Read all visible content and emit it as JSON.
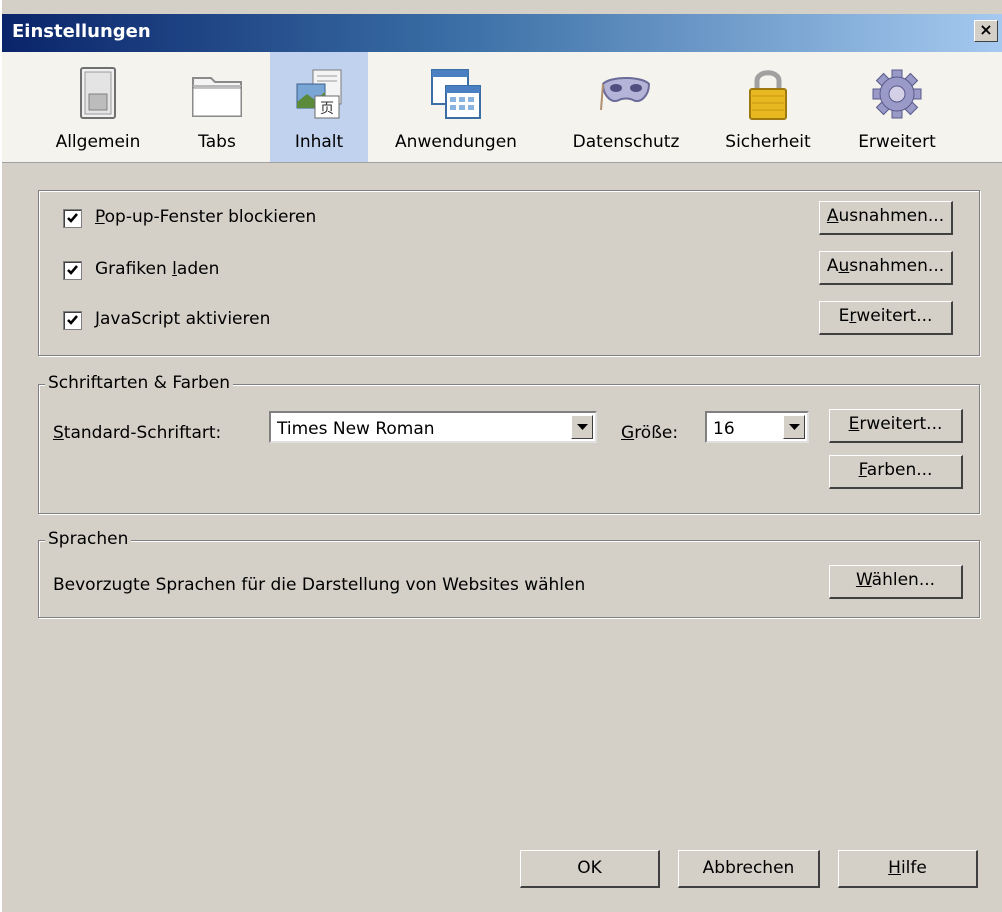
{
  "window": {
    "title": "Einstellungen",
    "close_label": "×"
  },
  "toolbar": {
    "items": [
      {
        "label": "Allgemein",
        "icon": "switch-icon"
      },
      {
        "label": "Tabs",
        "icon": "folder-icon"
      },
      {
        "label": "Inhalt",
        "icon": "content-icon",
        "selected": true
      },
      {
        "label": "Anwendungen",
        "icon": "applications-icon"
      },
      {
        "label": "Datenschutz",
        "icon": "mask-icon"
      },
      {
        "label": "Sicherheit",
        "icon": "lock-icon"
      },
      {
        "label": "Erweitert",
        "icon": "gear-icon"
      }
    ]
  },
  "content": {
    "popup": {
      "checked": true,
      "pre": "",
      "key": "P",
      "post": "op-up-Fenster blockieren",
      "button": {
        "pre": "",
        "key": "A",
        "post": "usnahmen..."
      }
    },
    "images": {
      "checked": true,
      "pre": "Grafiken ",
      "key": "l",
      "post": "aden",
      "button": {
        "pre": "A",
        "key": "u",
        "post": "snahmen..."
      }
    },
    "javascript": {
      "checked": true,
      "pre": "",
      "key": "J",
      "post": "avaScript aktivieren",
      "button": {
        "pre": "E",
        "key": "r",
        "post": "weitert..."
      }
    }
  },
  "fonts": {
    "legend": "Schriftarten & Farben",
    "default_font_label": {
      "pre": "",
      "key": "S",
      "post": "tandard-Schriftart:"
    },
    "default_font_value": "Times New Roman",
    "size_label": {
      "pre": "",
      "key": "G",
      "post": "röße:"
    },
    "size_value": "16",
    "advanced_button": {
      "pre": "",
      "key": "E",
      "post": "rweitert..."
    },
    "colors_button": {
      "pre": "",
      "key": "F",
      "post": "arben..."
    }
  },
  "languages": {
    "legend": "Sprachen",
    "description": "Bevorzugte Sprachen für die Darstellung von Websites wählen",
    "choose_button": {
      "pre": "",
      "key": "W",
      "post": "ählen..."
    }
  },
  "footer": {
    "ok_label": "OK",
    "cancel_label": "Abbrechen",
    "help": {
      "pre": "",
      "key": "H",
      "post": "ilfe"
    }
  },
  "colors": {
    "title_start": "#0a246a",
    "title_end": "#a6caf0",
    "selected_tab": "#c1d2ee",
    "face": "#d4d0c8"
  }
}
